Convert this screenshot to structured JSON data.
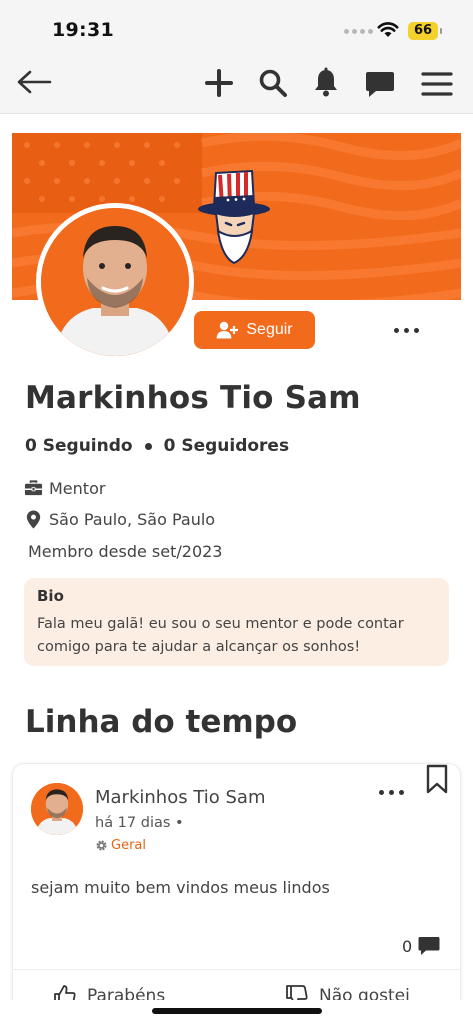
{
  "status_bar": {
    "time": "19:31",
    "battery": "66"
  },
  "profile": {
    "name": "Markinhos Tio Sam",
    "following": "0 Seguindo",
    "followers": "0 Seguidores",
    "follow_button": "Seguir",
    "role": "Mentor",
    "location": "São Paulo, São Paulo",
    "member_since": "Membro desde set/2023",
    "bio_title": "Bio",
    "bio_text": "Fala meu galã! eu sou o seu mentor e pode contar comigo para te ajudar a alcançar os sonhos!"
  },
  "timeline": {
    "title": "Linha do tempo",
    "posts": [
      {
        "author": "Markinhos Tio Sam",
        "time": "há 17 dias •",
        "category": "Geral",
        "text": "sejam muito bem vindos meus lindos",
        "comments": "0",
        "like_label": "Parabéns",
        "dislike_label": "Não gostei"
      }
    ]
  },
  "colors": {
    "accent": "#f26a1b",
    "bio_bg": "#fdeee3"
  },
  "icons": [
    "back-arrow-icon",
    "plus-icon",
    "search-icon",
    "bell-icon",
    "chat-icon",
    "menu-icon",
    "user-plus-icon",
    "briefcase-icon",
    "location-pin-icon",
    "gear-icon",
    "bookmark-icon",
    "comment-icon",
    "thumbs-up-icon",
    "thumbs-down-icon"
  ]
}
